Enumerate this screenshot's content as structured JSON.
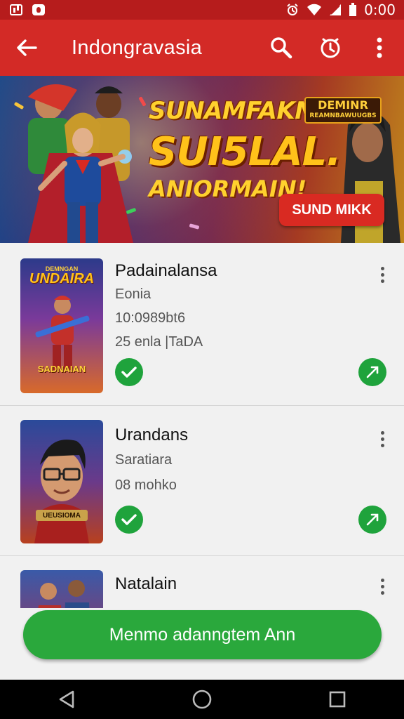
{
  "status_bar": {
    "time": "0:00",
    "icons": [
      "gallery-icon",
      "app-notification-icon",
      "alarm-icon",
      "wifi-icon",
      "signal-icon",
      "battery-icon"
    ]
  },
  "app_bar": {
    "title": "Indongravasia",
    "icons": [
      "back-arrow-icon",
      "search-icon",
      "history-icon",
      "more-vert-icon"
    ]
  },
  "banner": {
    "line1": "SUNAMFAKN !",
    "line2": "SUI5LAL.",
    "line3": "ANIORMAIN!",
    "badge_top": "DEMINR",
    "badge_sub": "REAMNBAWUUGBS",
    "cta": "SUND MIKK"
  },
  "list": {
    "items": [
      {
        "name": "Padainalansa",
        "lines": [
          "Eonia",
          "10:0989bt6",
          "25 enla |TaDA"
        ],
        "thumb_title": "UNDAIRA",
        "thumb_top": "DEMNGAN",
        "thumb_bottom": "SADNAIAN",
        "status": "installed"
      },
      {
        "name": "Urandans",
        "lines": [
          "Saratiara",
          "08 mohko"
        ],
        "thumb_bottom": "UEUSIOMA",
        "status": "installed"
      },
      {
        "name": "Natalain",
        "lines": [],
        "status": "partial"
      }
    ]
  },
  "install_button": {
    "label": "Menmo adanngtem Ann"
  },
  "nav_bar": {
    "icons": [
      "back-triangle-icon",
      "home-circle-icon",
      "recents-square-icon"
    ]
  },
  "colors": {
    "primary": "#d32a26",
    "status_bar": "#b61c1c",
    "accent_green": "#2aa83c",
    "check_green": "#1fa33c"
  }
}
